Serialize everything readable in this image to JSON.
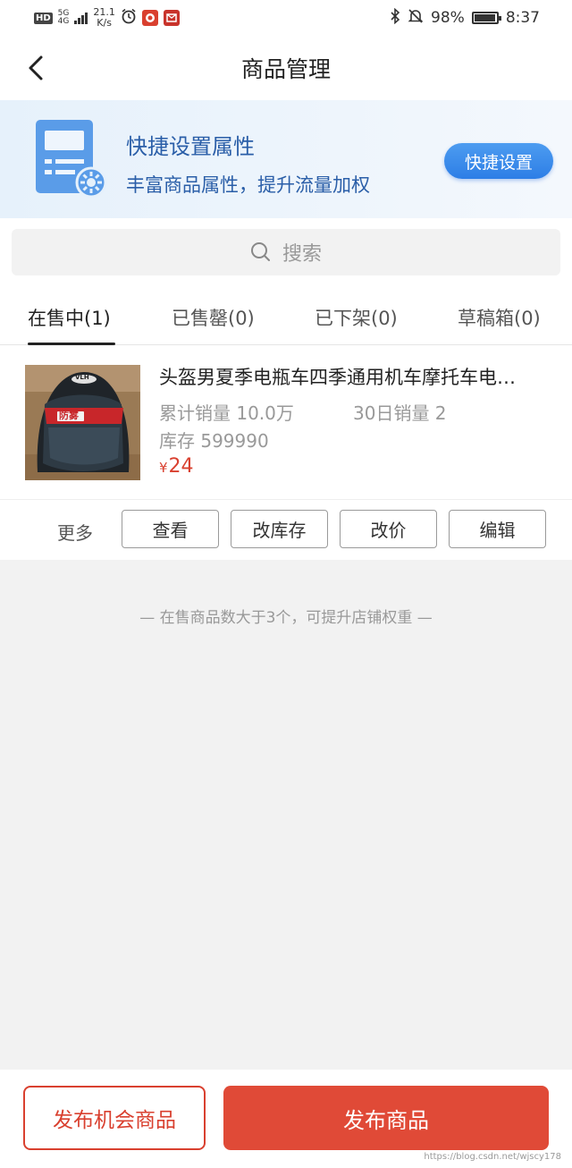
{
  "status_bar": {
    "hd": "HD",
    "network": "5G",
    "network_sub": "4G",
    "speed_value": "21.1",
    "speed_unit": "K/s",
    "battery_percent": "98%",
    "battery_level": 0.98,
    "time": "8:37"
  },
  "nav": {
    "title": "商品管理"
  },
  "banner": {
    "title": "快捷设置属性",
    "subtitle": "丰富商品属性，提升流量加权",
    "button_label": "快捷设置"
  },
  "search": {
    "placeholder": "搜索"
  },
  "tabs": [
    {
      "label": "在售中(1)",
      "active": true
    },
    {
      "label": "已售罄(0)",
      "active": false
    },
    {
      "label": "已下架(0)",
      "active": false
    },
    {
      "label": "草稿箱(0)",
      "active": false
    }
  ],
  "product": {
    "name": "头盔男夏季电瓶车四季通用机车摩托车电…",
    "total_sales": "累计销量 10.0万",
    "sales_30d": "30日销量 2",
    "stock": "库存 599990",
    "currency": "¥",
    "price": "24",
    "thumb_text": "防雾",
    "thumb_brand": "VLH",
    "more_label": "更多",
    "actions": [
      "查看",
      "改库存",
      "改价",
      "编辑"
    ]
  },
  "hint": "— 在售商品数大于3个，可提升店铺权重 —",
  "bottom": {
    "secondary_button": "发布机会商品",
    "primary_button": "发布商品"
  },
  "watermark": "https://blog.csdn.net/wjscy178",
  "colors": {
    "accent_red": "#e04a37",
    "banner_blue": "#2a5ea8",
    "button_blue": "#2d7ee6"
  }
}
